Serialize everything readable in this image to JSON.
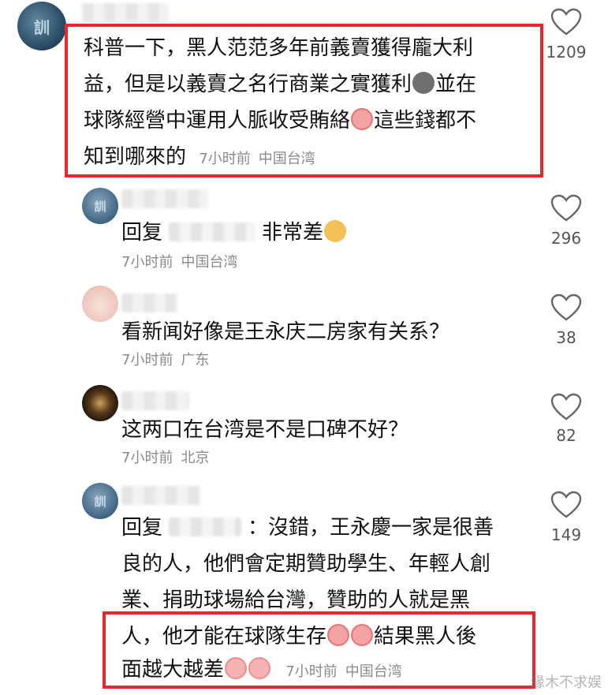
{
  "comments": [
    {
      "lines": [
        "科普一下，黑人范范多年前義賣獲得龐大利",
        "益，但是以義賣之名行商業之實獲利",
        "球隊經營中運用人脈收受賄絡",
        "知到哪來的"
      ],
      "line2_tail": "並在",
      "line3_tail": "這些錢都不",
      "time": "7小时前",
      "location": "中国台湾",
      "likes": "1209"
    },
    {
      "reply_prefix": "回复",
      "text": "非常差",
      "time": "7小时前",
      "location": "中国台湾",
      "likes": "296"
    },
    {
      "text": "看新闻好像是王永庆二房家有关系？",
      "time": "7小时前",
      "location": "广东",
      "likes": "38"
    },
    {
      "text": "这两口在台湾是不是口碑不好？",
      "time": "7小时前",
      "location": "北京",
      "likes": "82"
    },
    {
      "reply_prefix": "回复",
      "line1": "：沒錯，王永慶一家是很善",
      "line2": "良的人，他們會定期贊助學生、年輕人創",
      "line3": "業、捐助球場給台灣，贊助的人就是黑",
      "line4": "人，他才能在球隊生存",
      "line4_tail": "結果黑人後",
      "line5": "面越大越差",
      "time": "7小时前",
      "location": "中国台湾",
      "likes": "149"
    }
  ],
  "watermark": "缘木不求娱",
  "colors": {
    "highlight_box": "#e8262c",
    "meta_text": "#8a8a8a"
  }
}
